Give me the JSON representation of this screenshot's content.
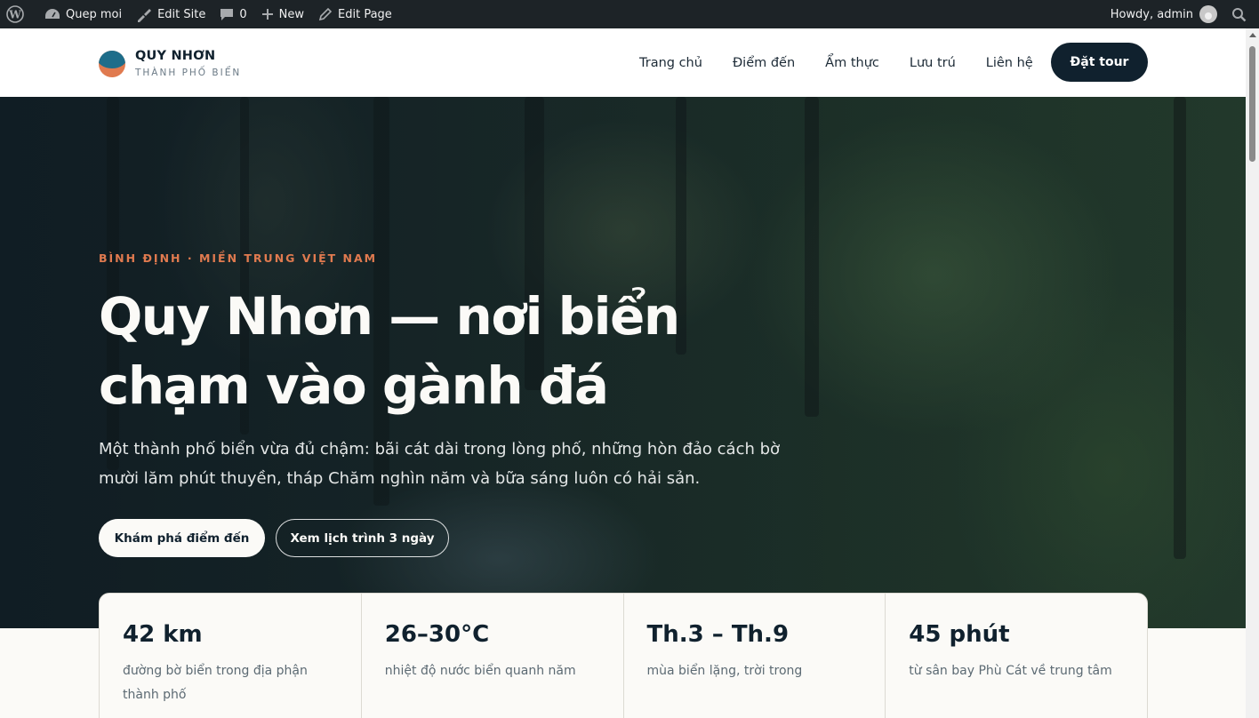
{
  "admin_bar": {
    "site_name": "Quep moi",
    "edit_site": "Edit Site",
    "comments_count": "0",
    "new_label": "New",
    "edit_page": "Edit Page",
    "howdy": "Howdy, admin"
  },
  "header": {
    "logo_title": "QUY NHƠN",
    "logo_subtitle": "THÀNH PHỐ BIỂN",
    "nav": [
      "Trang chủ",
      "Điểm đến",
      "Ẩm thực",
      "Lưu trú",
      "Liên hệ"
    ],
    "cta": "Đặt tour"
  },
  "hero": {
    "eyebrow": "BÌNH ĐỊNH · MIỀN TRUNG VIỆT NAM",
    "title_line1": "Quy Nhơn — nơi biển",
    "title_line2": "chạm vào gành đá",
    "lead": "Một thành phố biển vừa đủ chậm: bãi cát dài trong lòng phố, những hòn đảo cách bờ mười lăm phút thuyền, tháp Chăm nghìn năm và bữa sáng luôn có hải sản.",
    "primary_button": "Khám phá điểm đến",
    "secondary_button": "Xem lịch trình 3 ngày"
  },
  "stats": [
    {
      "value": "42 km",
      "desc": "đường bờ biển trong địa phận thành phố"
    },
    {
      "value": "26–30°C",
      "desc": "nhiệt độ nước biển quanh năm"
    },
    {
      "value": "Th.3 – Th.9",
      "desc": "mùa biển lặng, trời trong"
    },
    {
      "value": "45 phút",
      "desc": "từ sân bay Phù Cát về trung tâm"
    }
  ],
  "colors": {
    "admin_bar": "#1d2327",
    "navy": "#10212e",
    "accent": "#e07a4f",
    "sea": "#1e6d8a",
    "page_bg": "#fbfaf7"
  }
}
